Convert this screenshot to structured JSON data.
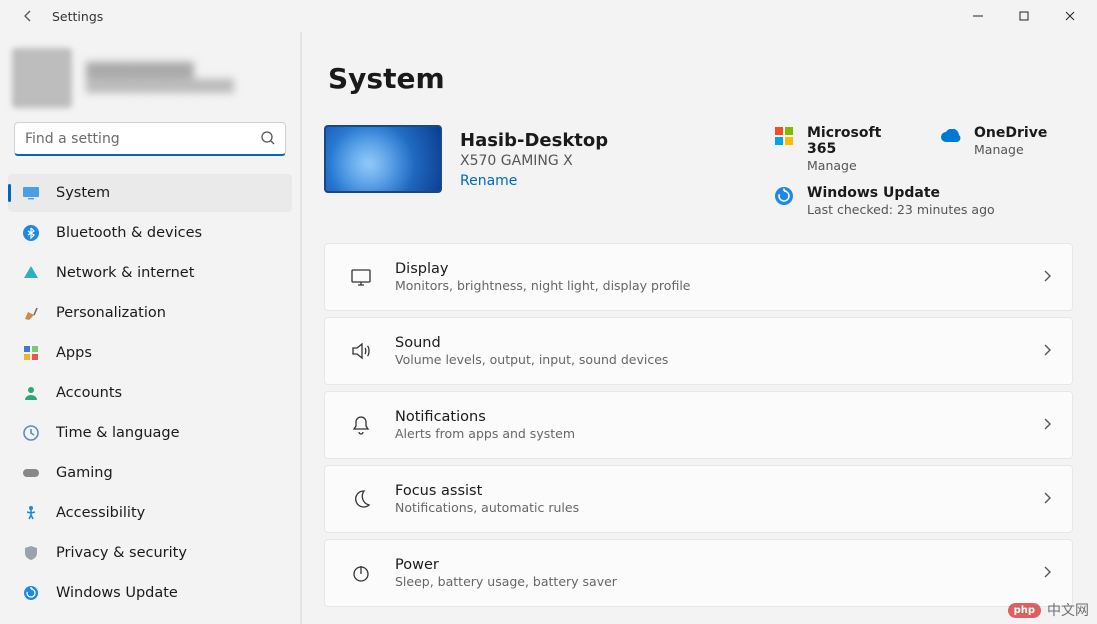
{
  "window": {
    "title": "Settings"
  },
  "profile": {
    "name_redacted": "██████████",
    "email_redacted": "████████████████"
  },
  "search": {
    "placeholder": "Find a setting"
  },
  "nav": [
    {
      "id": "system",
      "label": "System",
      "icon": "display-icon",
      "selected": true
    },
    {
      "id": "bluetooth",
      "label": "Bluetooth & devices",
      "icon": "bluetooth-icon"
    },
    {
      "id": "network",
      "label": "Network & internet",
      "icon": "wifi-icon"
    },
    {
      "id": "personalization",
      "label": "Personalization",
      "icon": "brush-icon"
    },
    {
      "id": "apps",
      "label": "Apps",
      "icon": "apps-icon"
    },
    {
      "id": "accounts",
      "label": "Accounts",
      "icon": "person-icon"
    },
    {
      "id": "time",
      "label": "Time & language",
      "icon": "clock-icon"
    },
    {
      "id": "gaming",
      "label": "Gaming",
      "icon": "gamepad-icon"
    },
    {
      "id": "accessibility",
      "label": "Accessibility",
      "icon": "accessibility-icon"
    },
    {
      "id": "privacy",
      "label": "Privacy & security",
      "icon": "shield-icon"
    },
    {
      "id": "update",
      "label": "Windows Update",
      "icon": "update-icon"
    }
  ],
  "page": {
    "title": "System",
    "device": {
      "name": "Hasib-Desktop",
      "model": "X570 GAMING X",
      "rename_label": "Rename"
    },
    "cloud": {
      "m365": {
        "title": "Microsoft 365",
        "sub": "Manage"
      },
      "onedrive": {
        "title": "OneDrive",
        "sub": "Manage"
      },
      "update": {
        "title": "Windows Update",
        "sub": "Last checked: 23 minutes ago"
      }
    },
    "cards": [
      {
        "id": "display",
        "title": "Display",
        "sub": "Monitors, brightness, night light, display profile",
        "icon": "monitor-icon"
      },
      {
        "id": "sound",
        "title": "Sound",
        "sub": "Volume levels, output, input, sound devices",
        "icon": "speaker-icon"
      },
      {
        "id": "notifications",
        "title": "Notifications",
        "sub": "Alerts from apps and system",
        "icon": "bell-icon"
      },
      {
        "id": "focus",
        "title": "Focus assist",
        "sub": "Notifications, automatic rules",
        "icon": "moon-icon"
      },
      {
        "id": "power",
        "title": "Power",
        "sub": "Sleep, battery usage, battery saver",
        "icon": "power-icon"
      }
    ]
  },
  "watermark": {
    "badge": "php",
    "text": "中文网"
  }
}
